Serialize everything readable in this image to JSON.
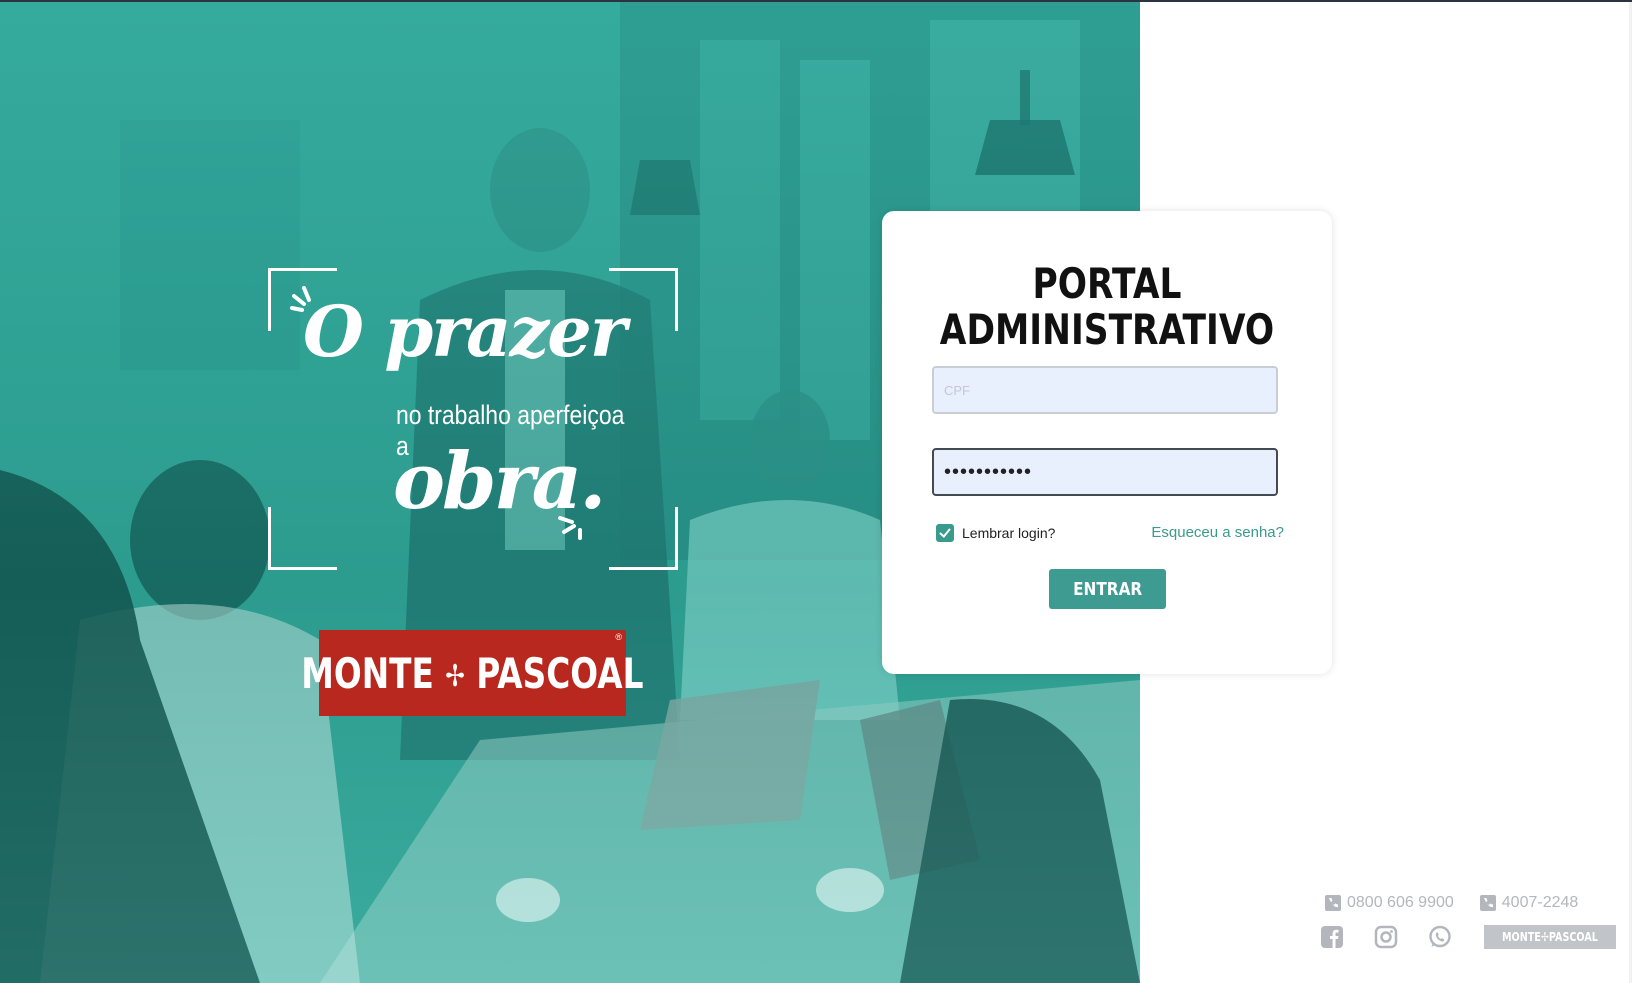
{
  "hero": {
    "slogan_line1": "O prazer",
    "slogan_line2": "no trabalho aperfeiçoa a",
    "slogan_line3": "obra.",
    "brand_left": "MONTE",
    "brand_right": "PASCOAL",
    "brand_reg": "®"
  },
  "login": {
    "title_line1": "PORTAL",
    "title_line2": "ADMINISTRATIVO",
    "cpf_placeholder": "CPF",
    "cpf_value": "",
    "password_value": "•••••••••••",
    "remember_label": "Lembrar login?",
    "remember_checked": true,
    "forgot_label": "Esqueceu a senha?",
    "submit_label": "ENTRAR"
  },
  "footer": {
    "phone1": "0800 606 9900",
    "phone2": "4007-2248",
    "logo_text": "MONTE✢PASCOAL",
    "icons": [
      "facebook-icon",
      "instagram-icon",
      "whatsapp-icon"
    ]
  },
  "colors": {
    "accent": "#3e9b91",
    "brand_red": "#b8281e",
    "hero_teal": "#38a89c"
  }
}
